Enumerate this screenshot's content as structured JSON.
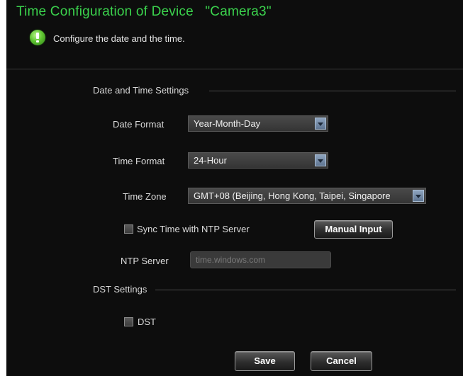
{
  "window": {
    "title": "Time Configuration of Device   \"Camera3\"",
    "subtitle": "Configure the date and the time.",
    "info_icon": "info-icon"
  },
  "date_time_section": {
    "label": "Date and Time Settings",
    "date_format": {
      "label": "Date Format",
      "value": "Year-Month-Day"
    },
    "time_format": {
      "label": "Time Format",
      "value": "24-Hour"
    },
    "time_zone": {
      "label": "Time Zone",
      "value": "GMT+08 (Beijing, Hong Kong, Taipei, Singapore"
    },
    "sync_ntp": {
      "label": "Sync Time with NTP Server",
      "checked": false
    },
    "manual_input_label": "Manual Input",
    "ntp_server": {
      "label": "NTP Server",
      "value": "",
      "placeholder": "time.windows.com"
    }
  },
  "dst_section": {
    "label": "DST Settings",
    "dst": {
      "label": "DST",
      "checked": false
    }
  },
  "footer": {
    "save_label": "Save",
    "cancel_label": "Cancel"
  },
  "colors": {
    "title": "#3bd34d",
    "background": "#0d0d0d",
    "dropdown_button": "#7088a6"
  }
}
